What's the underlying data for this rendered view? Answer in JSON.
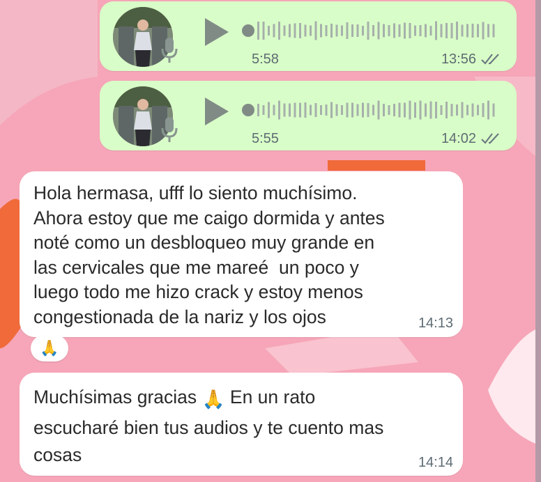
{
  "colors": {
    "background": "#f6a6b8",
    "outgoing_bubble": "#d9fdc8",
    "incoming_bubble": "#ffffff",
    "meta_text": "#5d6b73",
    "accent_orange": "#f06a3a"
  },
  "messages": [
    {
      "type": "audio",
      "direction": "outgoing",
      "duration": "5:58",
      "time": "13:56",
      "status": "read"
    },
    {
      "type": "audio",
      "direction": "outgoing",
      "duration": "5:55",
      "time": "14:02",
      "status": "read"
    },
    {
      "type": "text",
      "direction": "incoming",
      "text": "Hola hermasa, ufff lo siento muchísimo.\nAhora estoy que me caigo dormida y antes\nnoté como un desbloqueo muy grande en\nlas cervicales que me mareé  un poco y\nluego todo me hizo crack y estoy menos\ncongestionada de la nariz y los ojos",
      "time": "14:13",
      "reaction": "🙏"
    },
    {
      "type": "text",
      "direction": "incoming",
      "text_part1": "Muchísimas gracias",
      "emoji": "🙏",
      "text_part2": "En un rato",
      "text_rest": "escucharé bien tus audios y te cuento mas\ncosas",
      "time": "14:14"
    }
  ]
}
